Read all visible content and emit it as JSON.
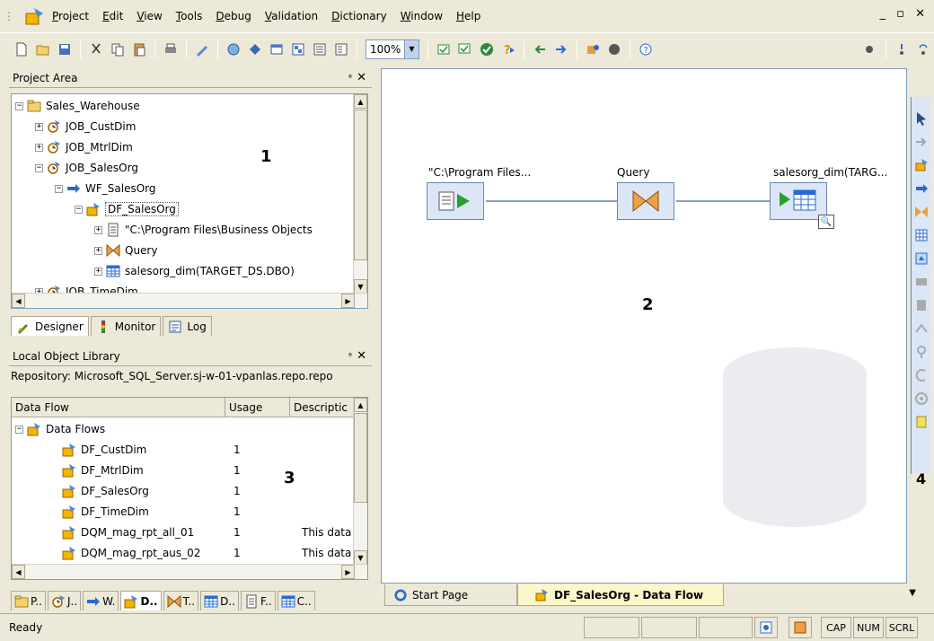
{
  "menu": {
    "items": [
      "Project",
      "Edit",
      "View",
      "Tools",
      "Debug",
      "Validation",
      "Dictionary",
      "Window",
      "Help"
    ],
    "window_controls": "_ ▫ ✕"
  },
  "toolbar": {
    "zoom": "100%"
  },
  "project_area": {
    "title": "Project Area",
    "pin": "ᵃ",
    "close": "✕",
    "tree": [
      {
        "label": "Sales_Warehouse",
        "icon": "folder-icon",
        "expander": "−",
        "indent": 0
      },
      {
        "label": "JOB_CustDim",
        "icon": "job-icon",
        "expander": "+",
        "indent": 1
      },
      {
        "label": "JOB_MtrlDim",
        "icon": "job-icon",
        "expander": "+",
        "indent": 1
      },
      {
        "label": "JOB_SalesOrg",
        "icon": "job-icon",
        "expander": "−",
        "indent": 1
      },
      {
        "label": "WF_SalesOrg",
        "icon": "workflow-icon",
        "expander": "−",
        "indent": 2
      },
      {
        "label": "DF_SalesOrg",
        "icon": "dataflow-icon",
        "expander": "−",
        "indent": 3
      },
      {
        "label": "\"C:\\Program Files\\Business Objects",
        "icon": "file-source-icon",
        "expander": "+",
        "indent": 4
      },
      {
        "label": "Query",
        "icon": "query-icon",
        "expander": "+",
        "indent": 4
      },
      {
        "label": "salesorg_dim(TARGET_DS.DBO)",
        "icon": "table-icon",
        "expander": "+",
        "indent": 4
      },
      {
        "label": "JOB_TimeDim",
        "icon": "job-icon",
        "expander": "+",
        "indent": 1
      }
    ],
    "tabs": [
      "Designer",
      "Monitor",
      "Log"
    ],
    "marker": "1"
  },
  "library": {
    "title": "Local Object Library",
    "pin": "ᵃ",
    "close": "✕",
    "repository": "Repository: Microsoft_SQL_Server.sj-w-01-vpanlas.repo.repo",
    "columns": [
      "Data Flow",
      "Usage",
      "Descriptic"
    ],
    "root": "Data Flows",
    "rows": [
      {
        "name": "DF_CustDim",
        "usage": "1",
        "desc": ""
      },
      {
        "name": "DF_MtrlDim",
        "usage": "1",
        "desc": ""
      },
      {
        "name": "DF_SalesOrg",
        "usage": "1",
        "desc": ""
      },
      {
        "name": "DF_TimeDim",
        "usage": "1",
        "desc": ""
      },
      {
        "name": "DQM_mag_rpt_all_01",
        "usage": "1",
        "desc": "This data"
      },
      {
        "name": "DQM_mag_rpt_aus_02",
        "usage": "1",
        "desc": "This data"
      }
    ],
    "bottom_tabs": [
      "P..",
      "J..",
      "W.",
      "D..",
      "T..",
      "D..",
      "F..",
      "C.."
    ],
    "marker": "3"
  },
  "canvas": {
    "nodes": [
      {
        "label": "\"C:\\Program Files...",
        "type": "source"
      },
      {
        "label": "Query",
        "type": "query"
      },
      {
        "label": "salesorg_dim(TARG...",
        "type": "target"
      }
    ],
    "marker": "2"
  },
  "palette": {
    "marker": "4"
  },
  "doc_tabs": [
    {
      "label": "Start Page",
      "active": false
    },
    {
      "label": "DF_SalesOrg - Data Flow",
      "active": true
    }
  ],
  "status": {
    "text": "Ready",
    "indicators": [
      "CAP",
      "NUM",
      "SCRL"
    ]
  }
}
